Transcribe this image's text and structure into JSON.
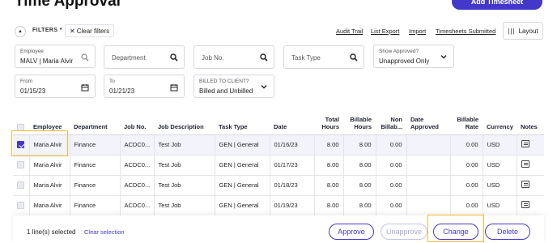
{
  "header": {
    "title": "Time Approval",
    "add_button": "Add Timesheet"
  },
  "filters_bar": {
    "label": "FILTERS *",
    "clear_filters": "Clear filters",
    "links": [
      "Audit Trail",
      "List Export",
      "Import",
      "Timesheets Submitted"
    ],
    "layout_button": "Layout"
  },
  "filters": {
    "employee_label": "Employee",
    "employee_value": "MALV | Maria Alvir",
    "department_placeholder": "Department",
    "job_placeholder": "Job No.",
    "task_placeholder": "Task Type",
    "show_approved_label": "Show Approved?",
    "show_approved_value": "Unapproved Only",
    "from_label": "From",
    "from_value": "01/15/23",
    "to_label": "To",
    "to_value": "01/21/23",
    "billed_label": "BILLED TO CLIENT?",
    "billed_value": "Billed and Unbilled"
  },
  "table": {
    "columns": {
      "employee": "Employee",
      "department": "Department",
      "job_no": "Job No.",
      "job_description": "Job Description",
      "task_type": "Task Type",
      "date": "Date",
      "total_hours_1": "Total",
      "total_hours_2": "Hours",
      "billable_hours_1": "Billable",
      "billable_hours_2": "Hours",
      "non_billable_1": "Non",
      "non_billable_2": "Billab...",
      "date_approved_1": "Date",
      "date_approved_2": "Approved",
      "billable_rate_1": "Billable",
      "billable_rate_2": "Rate",
      "currency": "Currency",
      "notes": "Notes"
    },
    "rows": [
      {
        "checked": true,
        "employee": "Maria Alvir",
        "department": "Finance",
        "job_no": "ACDC0...",
        "job_description": "Test Job",
        "task_type": "GEN | General",
        "date": "01/16/23",
        "total_hours": "8.00",
        "billable_hours": "8.00",
        "non_billable": "0.00",
        "date_approved": "",
        "billable_rate": "0.00",
        "currency": "USD"
      },
      {
        "checked": false,
        "employee": "Maria Alvir",
        "department": "Finance",
        "job_no": "ACDC0...",
        "job_description": "Test Job",
        "task_type": "GEN | General",
        "date": "01/17/23",
        "total_hours": "8.00",
        "billable_hours": "8.00",
        "non_billable": "0.00",
        "date_approved": "",
        "billable_rate": "0.00",
        "currency": "USD"
      },
      {
        "checked": false,
        "employee": "Maria Alvir",
        "department": "Finance",
        "job_no": "ACDC0...",
        "job_description": "Test Job",
        "task_type": "GEN | General",
        "date": "01/18/23",
        "total_hours": "8.00",
        "billable_hours": "8.00",
        "non_billable": "0.00",
        "date_approved": "",
        "billable_rate": "0.00",
        "currency": "USD"
      },
      {
        "checked": false,
        "employee": "Maria Alvir",
        "department": "Finance",
        "job_no": "ACDC0...",
        "job_description": "Test Job",
        "task_type": "GEN | General",
        "date": "01/19/23",
        "total_hours": "8.00",
        "billable_hours": "8.00",
        "non_billable": "0.00",
        "date_approved": "",
        "billable_rate": "0.00",
        "currency": "USD"
      },
      {
        "checked": false,
        "employee": "",
        "department": "",
        "job_no": "",
        "job_description": "",
        "task_type": "",
        "date": "",
        "total_hours": "",
        "billable_hours": "",
        "non_billable": "",
        "date_approved": "",
        "billable_rate": "",
        "currency": ""
      }
    ]
  },
  "footer": {
    "selected_count": "1 line(s) selected",
    "clear_selection": "Clear selection",
    "approve": "Approve",
    "unapprove": "Unapprove",
    "change": "Change",
    "delete": "Delete"
  },
  "colors": {
    "accent": "#4338ca",
    "highlight": "#f5b731"
  }
}
